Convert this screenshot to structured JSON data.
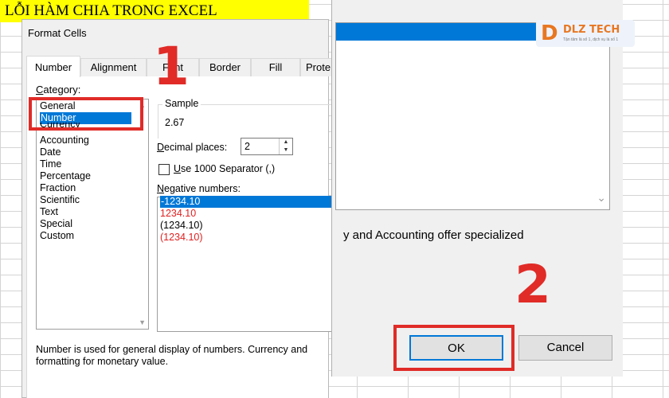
{
  "sheet": {
    "title_cell": "LỖI HÀM CHIA TRONG EXCEL"
  },
  "dialog": {
    "title": "Format Cells",
    "tabs": [
      "Number",
      "Alignment",
      "Font",
      "Border",
      "Fill",
      "Prote"
    ],
    "category_label": "Category:",
    "categories": [
      "General",
      "Number",
      "Currency",
      "Accounting",
      "Date",
      "Time",
      "Percentage",
      "Fraction",
      "Scientific",
      "Text",
      "Special",
      "Custom"
    ],
    "selected_category": "Number",
    "sample": {
      "label": "Sample",
      "value": "2.67"
    },
    "decimal_places": {
      "label": "Decimal places:",
      "value": "2"
    },
    "separator": {
      "label": "Use 1000 Separator (,)",
      "checked": false
    },
    "negative": {
      "label": "Negative numbers:",
      "items": [
        {
          "text": "-1234.10",
          "color": "#000000",
          "selected": true
        },
        {
          "text": "1234.10",
          "color": "#e02020",
          "selected": false
        },
        {
          "text": "(1234.10)",
          "color": "#000000",
          "selected": false
        },
        {
          "text": "(1234.10)",
          "color": "#e02020",
          "selected": false
        }
      ]
    },
    "description_line1": "Number is used for general display of numbers.  Currency and",
    "description_line2": "formatting for monetary value."
  },
  "right_pane": {
    "text": "y and Accounting offer specialized",
    "ok_label": "OK",
    "cancel_label": "Cancel"
  },
  "annotations": {
    "step1": "1",
    "step2": "2",
    "highlight_color": "#e02b27"
  },
  "logo": {
    "mark": "D",
    "name": "DLZ TECH",
    "tagline": "Tận tâm là số 1, dịch vụ là số 1"
  }
}
